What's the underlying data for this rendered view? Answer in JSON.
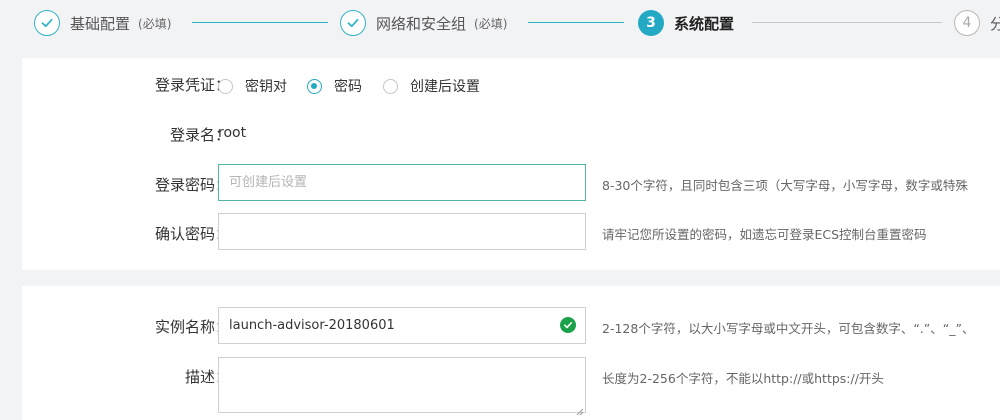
{
  "stepper": {
    "steps": [
      {
        "name": "基础配置",
        "required": "(必填)"
      },
      {
        "name": "网络和安全组",
        "required": "(必填)"
      },
      {
        "number": "3",
        "name": "系统配置"
      },
      {
        "number": "4",
        "name": "分"
      }
    ],
    "colors": {
      "done": "#33b3c6",
      "active": "#23a9c3",
      "todo": "#b8b8b8"
    }
  },
  "login_credential": {
    "label": "登录凭证：",
    "options": [
      "密钥对",
      "密码",
      "创建后设置"
    ],
    "selected": "密码"
  },
  "login_name": {
    "label": "登录名：",
    "value": "root"
  },
  "login_password": {
    "label": "登录密码：",
    "placeholder": "可创建后设置",
    "hint": "8-30个字符，且同时包含三项（大写字母，小写字母，数字或特殊"
  },
  "confirm_password": {
    "label": "确认密码：",
    "hint": "请牢记您所设置的密码，如遗忘可登录ECS控制台重置密码"
  },
  "instance_name": {
    "label": "实例名称：",
    "value": "launch-advisor-20180601",
    "hint": "2-128个字符，以大小写字母或中文开头，可包含数字、“.”、“_”、"
  },
  "description": {
    "label": "描述：",
    "hint": "长度为2-256个字符，不能以http://或https://开头"
  }
}
